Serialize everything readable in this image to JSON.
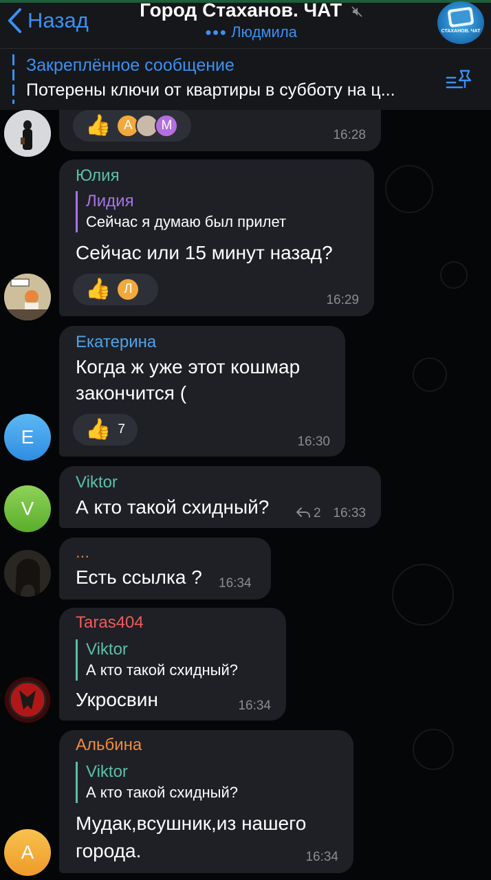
{
  "header": {
    "back_label": "Назад",
    "title": "Город Стаханов. ЧАТ",
    "typing_user": "Людмила",
    "avatar_caption": "СТАХАНОВ. ЧАТ"
  },
  "pinned": {
    "title": "Закреплённое сообщение",
    "text": "Потерены ключи от квартиры в субботу на ц..."
  },
  "messages": [
    {
      "time": "16:28",
      "reactions": {
        "emoji": "👍",
        "users": [
          "А",
          "",
          "М"
        ]
      }
    },
    {
      "sender": "Юлия",
      "reply": {
        "name": "Лидия",
        "text": "Сейчас я думаю был прилет"
      },
      "text": "Сейчас или 15 минут назад?",
      "time": "16:29",
      "reactions": {
        "emoji": "👍",
        "users": [
          "Л"
        ]
      }
    },
    {
      "sender": "Екатерина",
      "text_lines": [
        "Когда ж уже этот кошмар",
        "закончится ("
      ],
      "time": "16:30",
      "avatar_letter": "Е",
      "reactions": {
        "emoji": "👍",
        "count": "7"
      }
    },
    {
      "sender": "Viktor",
      "text": "А кто такой схидный?",
      "reply_count": "2",
      "time": "16:33",
      "avatar_letter": "V"
    },
    {
      "sender": "...",
      "text": "Есть ссылка ?",
      "time": "16:34"
    },
    {
      "sender": "Taras404",
      "reply": {
        "name": "Viktor",
        "text": "А кто такой схидный?"
      },
      "text": "Укросвин",
      "time": "16:34"
    },
    {
      "sender": "Альбина",
      "reply": {
        "name": "Viktor",
        "text": "А кто такой схидный?"
      },
      "text_lines": [
        "Мудак,всушник,из нашего",
        "города."
      ],
      "time": "16:34",
      "avatar_letter": "А"
    }
  ],
  "colors": {
    "accent": "#3a91f3",
    "bubble": "#1f2026",
    "julia": "#5bc0a8",
    "lidia": "#a675e6",
    "ekaterina": "#4fa3ea",
    "viktor": "#5bc0a8",
    "dots": "#e0783c",
    "taras": "#ef5b5b",
    "albina": "#f08c3a"
  }
}
